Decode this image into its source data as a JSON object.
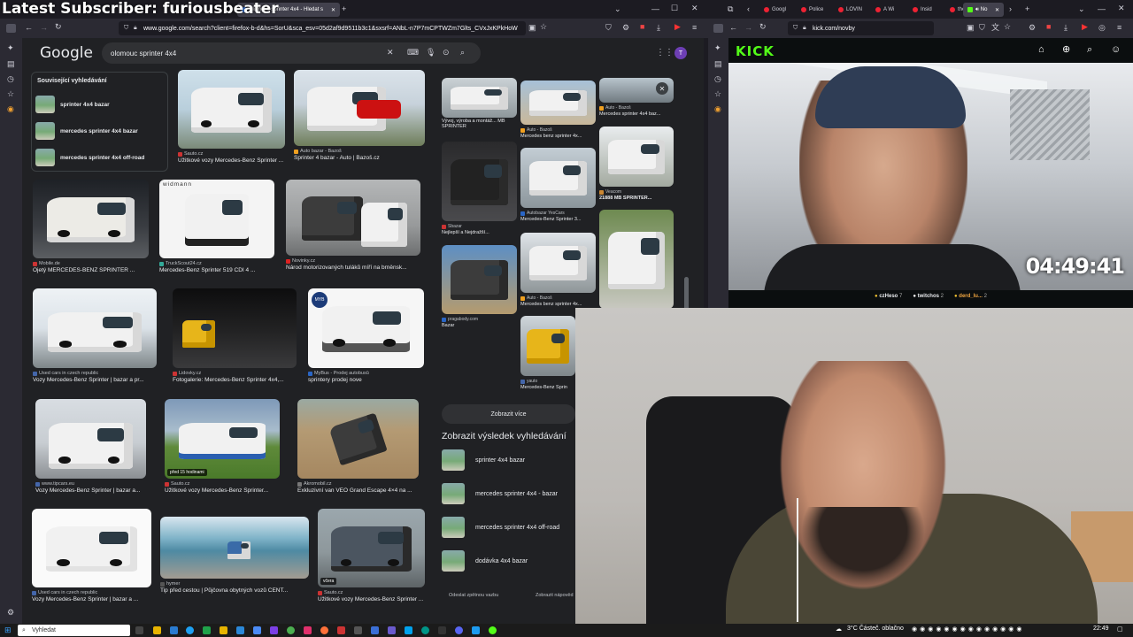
{
  "overlay": {
    "subscriber_text": "Latest Subscriber: furiousbeater"
  },
  "left_browser": {
    "tabs": [
      {
        "label": "olomouc sprinter 4x4 - Hledat s"
      }
    ],
    "url": "www.google.com/search?client=firefox-b-d&hs=SorU&sca_esv=05d2af9d9511b3c1&sxsrf=ANbL-n7P7mCPTWZm7Glts_CVxJxKPkHoW",
    "search": {
      "logo": "Google",
      "query": "olomouc sprinter 4x4",
      "avatar_letter": "T"
    },
    "related": {
      "heading": "Související vyhledávání",
      "items": [
        {
          "label": "sprinter 4x4 bazar"
        },
        {
          "label": "mercedes sprinter 4x4 bazar"
        },
        {
          "label": "mercedes sprinter 4x4 off-road"
        }
      ]
    },
    "results": [
      {
        "source": "Sauto.cz",
        "title": "Užitkové vozy Mercedes-Benz Sprinter ..."
      },
      {
        "source": "Auto bazar - Bazoš",
        "title": "Sprinter 4 bazar - Auto | Bazoš.cz"
      },
      {
        "source": "Mobile.de",
        "title": "Ojetý MERCEDES-BENZ SPRINTER ..."
      },
      {
        "source": "TruckScout24.cz",
        "title": "Mercedes-Benz Sprinter 519 CDI 4 ...",
        "brand": "widmann"
      },
      {
        "source": "Novinky.cz",
        "title": "Národ motorizovaných tuláků míří na brněnsk..."
      },
      {
        "source": "Used cars in czech republic",
        "title": "Vozy Mercedes-Benz Sprinter | bazar a pr..."
      },
      {
        "source": "Lidovky.cz",
        "title": "Fotogalerie: Mercedes-Benz Sprinter 4x4,..."
      },
      {
        "source": "MyBus - Prodej autobusů",
        "title": "sprintery prodej nove",
        "brand": "MYB"
      },
      {
        "source": "www.tipcars.eu",
        "title": "Vozy Mercedes-Benz Sprinter | bazar a..."
      },
      {
        "source": "Sauto.cz",
        "title": "Užitkové vozy Mercedes-Benz Sprinter...",
        "badge": "před 15 hodinami"
      },
      {
        "source": "Akromobil.cz",
        "title": "Exkluzivní van VEO Grand Escape 4×4 na ..."
      },
      {
        "source": "Used cars in czech republic",
        "title": "Vozy Mercedes-Benz Sprinter | bazar a ..."
      },
      {
        "source": "hymer",
        "title": "Tip před cestou | Půjčovna obytných vozů CENT..."
      },
      {
        "source": "Sauto.cz",
        "title": "Užitkové vozy Mercedes-Benz Sprinter ...",
        "badge": "včera"
      }
    ],
    "side_results": [
      {
        "source": "",
        "title": "Vývoj, výroba a montáž... MB SPRINTER"
      },
      {
        "source": "Auto - Bazoš",
        "title": "Mercedes benz sprinter 4x..."
      },
      {
        "source": "Auto - Bazoš",
        "title": "Mercedes sprinter 4x4 baz..."
      },
      {
        "source": "Sbazar",
        "title": "Nejlepší a Nejdražší..."
      },
      {
        "source": "Autobazar YesCars",
        "title": "Mercedes-Benz Sprinter 3..."
      },
      {
        "source": "Veacom",
        "title": "21888 MB SPRINTER..."
      },
      {
        "source": "pragabody.com",
        "title": "Bazar"
      },
      {
        "source": "Auto - Bazoš",
        "title": "Mercedes benz sprinter 4x..."
      },
      {
        "source": "yauto",
        "title": "Mercedes-Benz Sprin"
      }
    ],
    "more_button": "Zobrazit více",
    "show_results_heading": "Zobrazit výsledek vyhledávání",
    "more_searches": [
      {
        "label": "sprinter 4x4 bazar"
      },
      {
        "label": "mercedes sprinter 4x4 - bazar"
      },
      {
        "label": "mercedes sprinter 4x4 off-road"
      },
      {
        "label": "dodávka 4x4 bazar"
      }
    ],
    "footer": {
      "feedback": "Odeslat zpětnou vazbu",
      "help": "Zobrazit nápověd"
    }
  },
  "right_browser": {
    "tabs": [
      {
        "label": "Googl"
      },
      {
        "label": "Police"
      },
      {
        "label": "LOVIN"
      },
      {
        "label": "A Wi"
      },
      {
        "label": "Insid"
      },
      {
        "label": "the n"
      },
      {
        "label": "No"
      }
    ],
    "url": "kick.com/novby",
    "kick_logo": "KICK",
    "timer": "04:49:41",
    "chat_events": [
      {
        "user": "czHeso",
        "count": "7"
      },
      {
        "user": "twitchos",
        "count": "2"
      },
      {
        "user": "derd_lu...",
        "count": "2"
      }
    ]
  },
  "taskbar": {
    "search_placeholder": "Vyhledat",
    "weather": "3°C  Částeč. oblačno",
    "clock": "22:49"
  }
}
